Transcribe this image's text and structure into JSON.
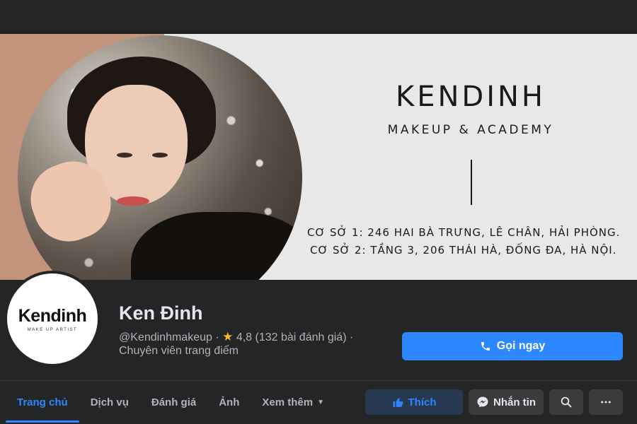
{
  "cover": {
    "brand_name": "KENDINH",
    "brand_sub": "MAKEUP & ACADEMY",
    "address_1": "CƠ SỞ 1: 246 HAI BÀ TRƯNG, LÊ CHÂN, HẢI PHÒNG.",
    "address_2": "CƠ SỞ 2: TẦNG 3, 206 THÁI HÀ, ĐỐNG ĐA, HÀ NỘI."
  },
  "avatar": {
    "logo_name": "Kendinh",
    "logo_sub": "MAKE UP ARTIST"
  },
  "profile": {
    "name": "Ken Đinh",
    "handle": "@Kendinhmakeup",
    "separator": "·",
    "rating": "4,8",
    "reviews": "(132 bài đánh giá)",
    "category": "Chuyên viên trang điểm"
  },
  "call_button": {
    "label": "Gọi ngay"
  },
  "tabs": [
    {
      "label": "Trang chủ",
      "active": true
    },
    {
      "label": "Dịch vụ"
    },
    {
      "label": "Đánh giá"
    },
    {
      "label": "Ảnh"
    },
    {
      "label": "Xem thêm"
    }
  ],
  "actions": {
    "like_label": "Thích",
    "message_label": "Nhắn tin"
  },
  "icons": {
    "star": "star-icon",
    "phone": "phone-icon",
    "thumb": "thumbs-up-icon",
    "messenger": "messenger-icon",
    "search": "search-icon",
    "more": "more-icon",
    "caret": "caret-down-icon"
  },
  "colors": {
    "accent": "#2d88ff",
    "background": "#242526",
    "star": "#f7b928"
  }
}
